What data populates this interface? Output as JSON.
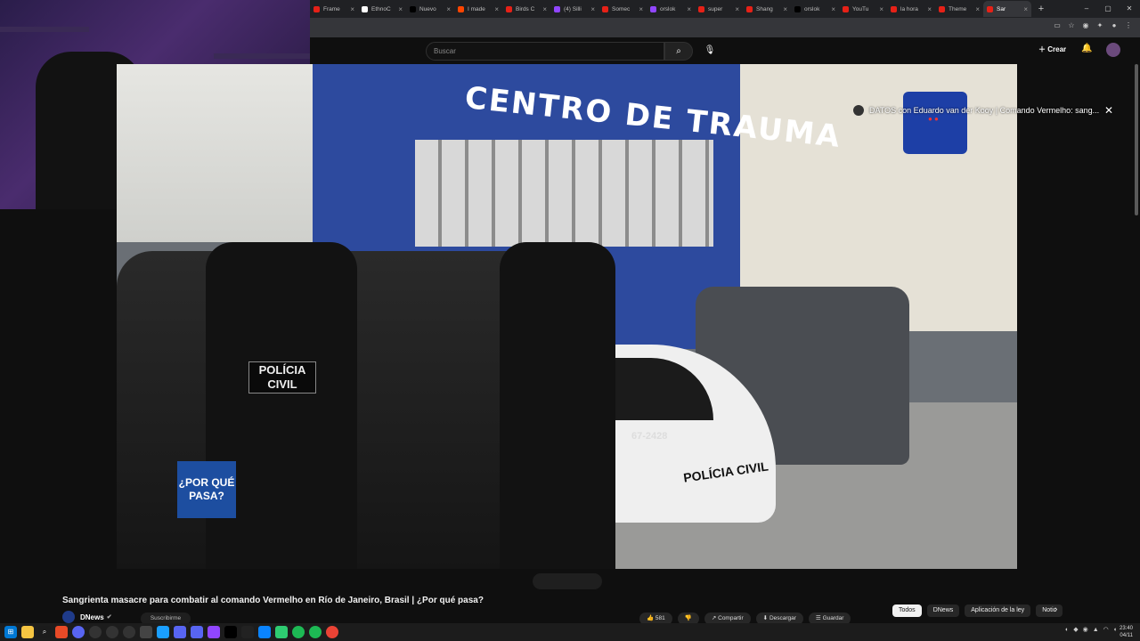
{
  "browser": {
    "tabs": [
      {
        "title": "Frame",
        "color": "#e62117"
      },
      {
        "title": "EthnoC",
        "color": "#ffffff"
      },
      {
        "title": "Nuevo",
        "color": "#000000"
      },
      {
        "title": "I made",
        "color": "#ff4500"
      },
      {
        "title": "Birds C",
        "color": "#e62117"
      },
      {
        "title": "(4) Silli",
        "color": "#9146ff"
      },
      {
        "title": "Somec",
        "color": "#e62117"
      },
      {
        "title": "orslok",
        "color": "#9146ff"
      },
      {
        "title": "super",
        "color": "#e62117"
      },
      {
        "title": "Shang",
        "color": "#e62117"
      },
      {
        "title": "orslok",
        "color": "#000000"
      },
      {
        "title": "YouTu",
        "color": "#e62117"
      },
      {
        "title": "la hora",
        "color": "#e62117"
      },
      {
        "title": "Theme",
        "color": "#e62117"
      },
      {
        "title": "Sar",
        "color": "#e62117",
        "active": true
      }
    ],
    "new_tab_glyph": "+",
    "window_controls": [
      "–",
      "▢",
      "✕"
    ]
  },
  "youtube": {
    "search_placeholder": "Buscar",
    "create_label": "Crear",
    "overlay_title": "DATOS con Eduardo van der Kooy | Comando Vermelho: sang...",
    "video_title": "Sangrienta masacre para combatir al comando Vermelho en Río de Janeiro, Brasil | ¿Por qué pasa?",
    "channel_name": "DNews",
    "subscribe_label": "Suscribirme",
    "actions": [
      "581",
      "",
      "Compartir",
      "Descargar",
      "Guardar"
    ],
    "chips": [
      {
        "label": "Todos",
        "active": true
      },
      {
        "label": "DNews",
        "active": false
      },
      {
        "label": "Aplicación de la ley",
        "active": false
      },
      {
        "label": "Notic",
        "active": false
      }
    ]
  },
  "video_scene": {
    "building_sign": "CENTRO DE TRAUMA",
    "vest_text": "POLÍCIA CIVIL",
    "car_label": "POLÍCIA CIVIL",
    "car_number": "67-2428",
    "badge_text": "¿POR QUÉ PASA?"
  },
  "taskbar": {
    "time": "23:40",
    "date": "04/11"
  }
}
